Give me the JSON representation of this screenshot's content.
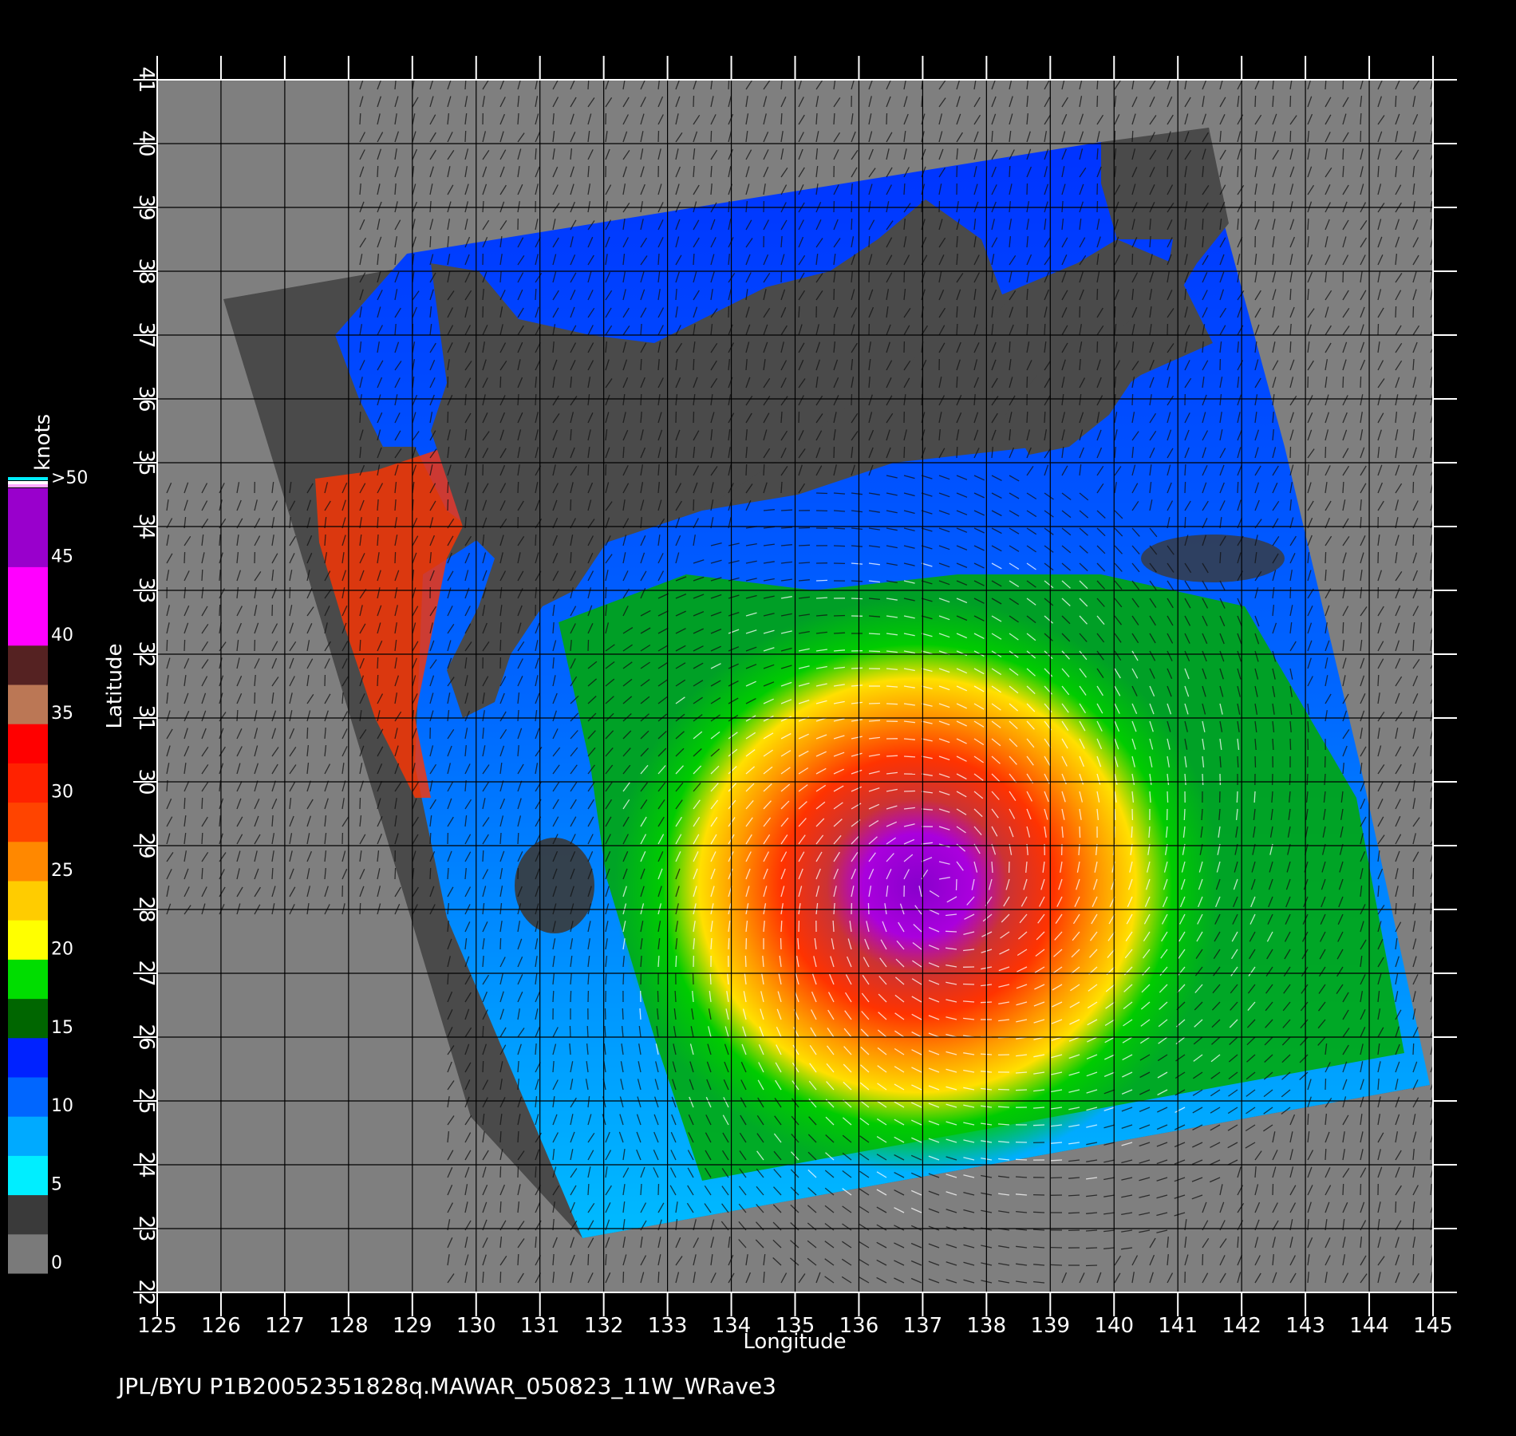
{
  "map": {
    "lon_range": [
      125,
      145
    ],
    "lat_range": [
      22,
      41
    ],
    "lon_ticks": [
      "125",
      "126",
      "127",
      "128",
      "129",
      "130",
      "131",
      "132",
      "133",
      "134",
      "135",
      "136",
      "137",
      "138",
      "139",
      "140",
      "141",
      "142",
      "143",
      "144",
      "145"
    ],
    "lat_ticks": [
      "22",
      "23",
      "24",
      "25",
      "26",
      "27",
      "28",
      "29",
      "30",
      "31",
      "32",
      "33",
      "34",
      "35",
      "36",
      "37",
      "38",
      "39",
      "40",
      "41"
    ],
    "xlabel": "Longitude",
    "ylabel": "Latitude",
    "storm_center": {
      "lon": 137.3,
      "lat": 28.4
    },
    "colors": {
      "background": "#000000",
      "nodata": "#7f7f7f",
      "land": "#4a4a4a",
      "grid": "#000000"
    }
  },
  "colorbar": {
    "unit": "knots",
    "labels": [
      {
        "text": "0",
        "value": 0
      },
      {
        "text": "5",
        "value": 5
      },
      {
        "text": "10",
        "value": 10
      },
      {
        "text": "15",
        "value": 15
      },
      {
        "text": "20",
        "value": 20
      },
      {
        "text": "25",
        "value": 25
      },
      {
        "text": "30",
        "value": 30
      },
      {
        "text": "35",
        "value": 35
      },
      {
        "text": "40",
        "value": 40
      },
      {
        "text": "45",
        "value": 45
      },
      {
        "text": ">50",
        "value": 50
      }
    ],
    "colors": [
      "#6f6f6f",
      "#3a3a3a",
      "#00f0ff",
      "#0088ff",
      "#0018ff",
      "#006600",
      "#00ee00",
      "#ffee00",
      "#ff9900",
      "#ff4400",
      "#ee0000",
      "#aa6644",
      "#ff00ff",
      "#8800cc"
    ]
  },
  "footer": {
    "text": "JPL/BYU  P1B20052351828q.MAWAR_050823_11W_WRave3"
  }
}
